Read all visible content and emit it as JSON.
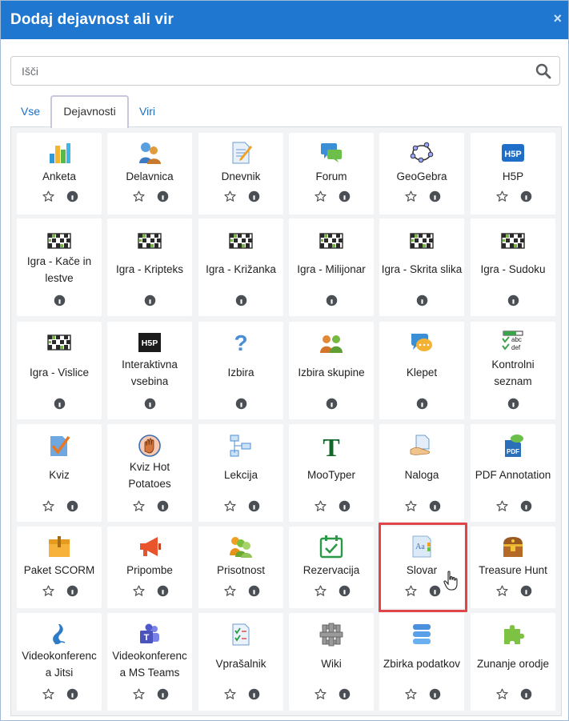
{
  "dialog": {
    "title": "Dodaj dejavnost ali vir",
    "close_symbol": "×"
  },
  "search": {
    "placeholder": "Išči",
    "value": ""
  },
  "tabs": [
    {
      "label": "Vse"
    },
    {
      "label": "Dejavnosti",
      "active": true
    },
    {
      "label": "Viri"
    }
  ],
  "items": [
    {
      "label": "Anketa",
      "icon": "bar-chart-icon",
      "starred": false
    },
    {
      "label": "Delavnica",
      "icon": "workshop-icon",
      "starred": false
    },
    {
      "label": "Dnevnik",
      "icon": "journal-icon",
      "starred": false
    },
    {
      "label": "Forum",
      "icon": "forum-icon",
      "starred": false
    },
    {
      "label": "GeoGebra",
      "icon": "geogebra-icon",
      "starred": false
    },
    {
      "label": "H5P",
      "icon": "h5p-icon",
      "starred": false
    },
    {
      "label": "Igra - Kače in lestve",
      "label_lines": [
        "Igra - Kače in",
        "lestve"
      ],
      "icon": "game-grid-icon",
      "info_only": true
    },
    {
      "label": "Igra - Kripteks",
      "icon": "game-grid-icon",
      "info_only": true
    },
    {
      "label": "Igra - Križanka",
      "icon": "game-grid-icon",
      "info_only": true
    },
    {
      "label": "Igra - Milijonar",
      "icon": "game-grid-icon",
      "info_only": true
    },
    {
      "label": "Igra - Skrita slika",
      "icon": "game-grid-icon",
      "info_only": true
    },
    {
      "label": "Igra - Sudoku",
      "icon": "game-grid-icon",
      "info_only": true
    },
    {
      "label": "Igra - Vislice",
      "icon": "game-grid-icon",
      "info_only": true
    },
    {
      "label": "Interaktivna vsebina",
      "label_lines": [
        "Interaktivna",
        "vsebina"
      ],
      "icon": "h5p-dark-icon",
      "info_only": true
    },
    {
      "label": "Izbira",
      "icon": "question-icon",
      "info_only": true
    },
    {
      "label": "Izbira skupine",
      "icon": "group-choice-icon",
      "info_only": true
    },
    {
      "label": "Klepet",
      "icon": "chat-icon",
      "info_only": true
    },
    {
      "label": "Kontrolni seznam",
      "label_lines": [
        "Kontrolni",
        "seznam"
      ],
      "icon": "checklist-icon",
      "info_only": true
    },
    {
      "label": "Kviz",
      "icon": "quiz-icon",
      "starred": false
    },
    {
      "label": "Kviz Hot Potatoes",
      "label_lines": [
        "Kviz Hot",
        "Potatoes"
      ],
      "icon": "hot-potatoes-icon",
      "starred": false
    },
    {
      "label": "Lekcija",
      "icon": "lesson-icon",
      "starred": false
    },
    {
      "label": "MooTyper",
      "icon": "mootyper-icon",
      "starred": false
    },
    {
      "label": "Naloga",
      "icon": "assignment-icon",
      "starred": false
    },
    {
      "label": "PDF Annotation",
      "icon": "pdf-icon",
      "starred": false
    },
    {
      "label": "Paket SCORM",
      "icon": "scorm-icon",
      "starred": false
    },
    {
      "label": "Pripombe",
      "icon": "megaphone-icon",
      "starred": false
    },
    {
      "label": "Prisotnost",
      "icon": "attendance-icon",
      "starred": false
    },
    {
      "label": "Rezervacija",
      "icon": "calendar-check-icon",
      "starred": false
    },
    {
      "label": "Slovar",
      "icon": "glossary-icon",
      "starred": false
    },
    {
      "label": "Treasure Hunt",
      "icon": "treasure-chest-icon",
      "starred": false
    },
    {
      "label": "Videokonferenca Jitsi",
      "label_lines": [
        "Videokonferenc",
        "a Jitsi"
      ],
      "icon": "jitsi-icon",
      "starred": false
    },
    {
      "label": "Videokonferenca MS Teams",
      "label_lines": [
        "Videokonferenc",
        "a MS Teams"
      ],
      "icon": "teams-icon",
      "starred": false
    },
    {
      "label": "Vprašalnik",
      "icon": "questionnaire-icon",
      "starred": false
    },
    {
      "label": "Wiki",
      "icon": "wiki-icon",
      "starred": false
    },
    {
      "label": "Zbirka podatkov",
      "icon": "database-icon",
      "starred": false
    },
    {
      "label": "Zunanje orodje",
      "icon": "puzzle-icon",
      "starred": false
    }
  ],
  "highlighted_item": "Slovar",
  "colors": {
    "header": "#1f77d0",
    "link": "#1a6fc4",
    "highlight": "#e0454a",
    "panel_bg": "#f1f3f5"
  }
}
